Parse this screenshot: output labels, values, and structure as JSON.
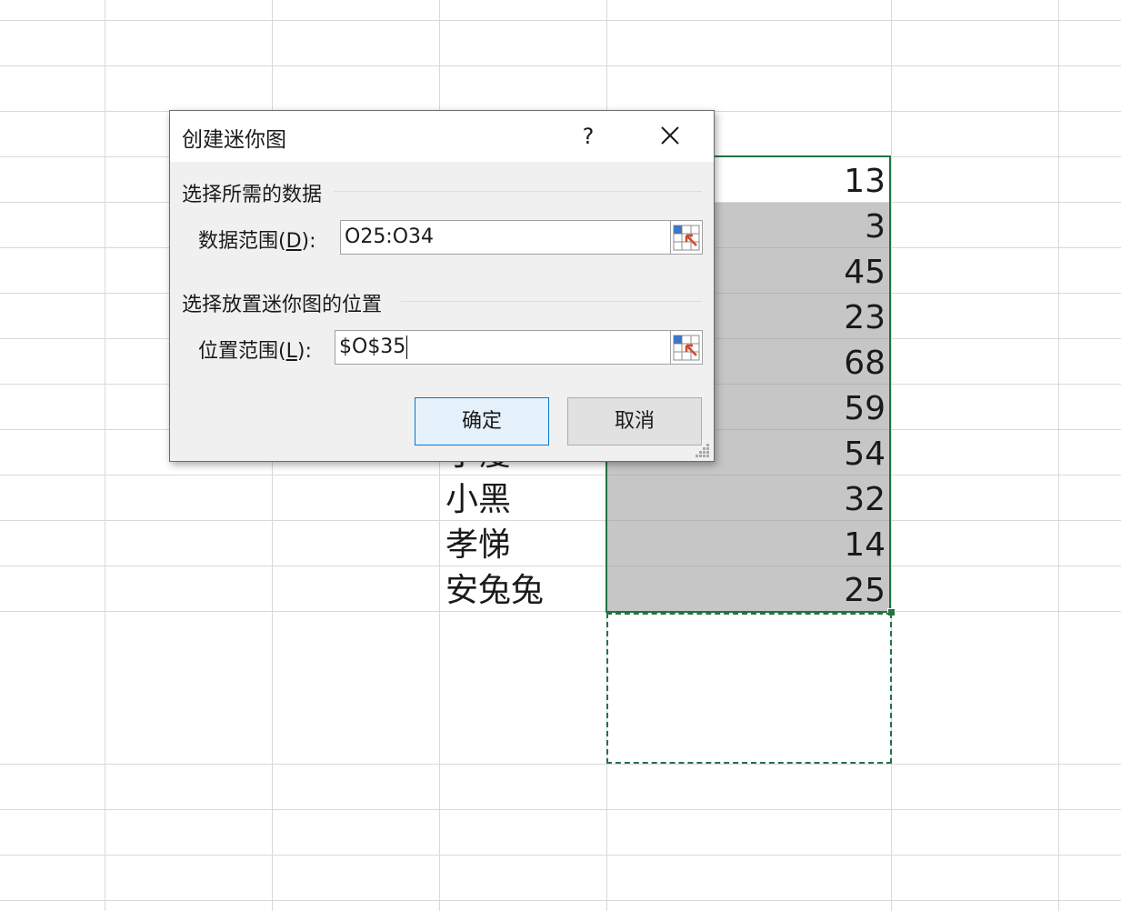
{
  "sheet": {
    "names": [
      "小瘦",
      "小黑",
      "孝悌",
      "安兔兔"
    ],
    "values": [
      "13",
      "3",
      "45",
      "23",
      "68",
      "59",
      "54",
      "32",
      "14",
      "25"
    ]
  },
  "dialog": {
    "title": "创建迷你图",
    "help_label": "?",
    "section_data_label": "选择所需的数据",
    "data_range_label_prefix": "数据范围(",
    "data_range_hotkey": "D",
    "data_range_label_suffix": "):",
    "data_range_value": "O25:O34",
    "section_location_label": "选择放置迷你图的位置",
    "location_range_label_prefix": "位置范围(",
    "location_range_hotkey": "L",
    "location_range_label_suffix": "):",
    "location_range_value": "$O$35",
    "ok_label": "确定",
    "cancel_label": "取消"
  },
  "colors": {
    "selection_border": "#217346",
    "selected_fill": "#c6c6c6",
    "ok_button_border": "#0078d7",
    "ref_icon_blue": "#3c78c8",
    "ref_icon_red": "#d04a2a"
  },
  "icons": {
    "close": "close-icon",
    "range_picker": "range-picker-icon",
    "resize_grip": "resize-grip-icon"
  }
}
